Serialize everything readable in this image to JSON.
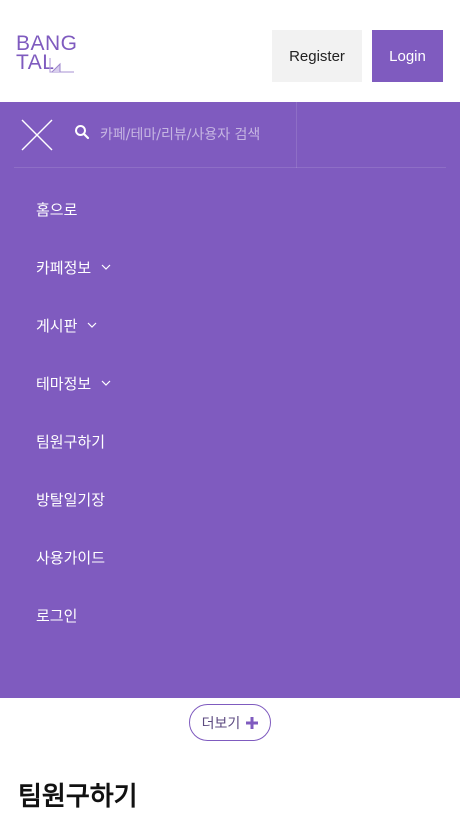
{
  "header": {
    "logo_line1": "BANG",
    "logo_line2": "TAL",
    "register_label": "Register",
    "login_label": "Login"
  },
  "search": {
    "placeholder": "카페/테마/리뷰/사용자 검색"
  },
  "menu": {
    "items": [
      {
        "label": "홈으로",
        "has_dropdown": false
      },
      {
        "label": "카페정보",
        "has_dropdown": true
      },
      {
        "label": "게시판",
        "has_dropdown": true
      },
      {
        "label": "테마정보",
        "has_dropdown": true
      },
      {
        "label": "팀원구하기",
        "has_dropdown": false
      },
      {
        "label": "방탈일기장",
        "has_dropdown": false
      },
      {
        "label": "사용가이드",
        "has_dropdown": false
      },
      {
        "label": "로그인",
        "has_dropdown": false
      }
    ]
  },
  "more": {
    "label": "더보기"
  },
  "section": {
    "title": "팀원구하기"
  },
  "colors": {
    "brand": "#7f5bbf",
    "register_bg": "#f2f2f2"
  }
}
